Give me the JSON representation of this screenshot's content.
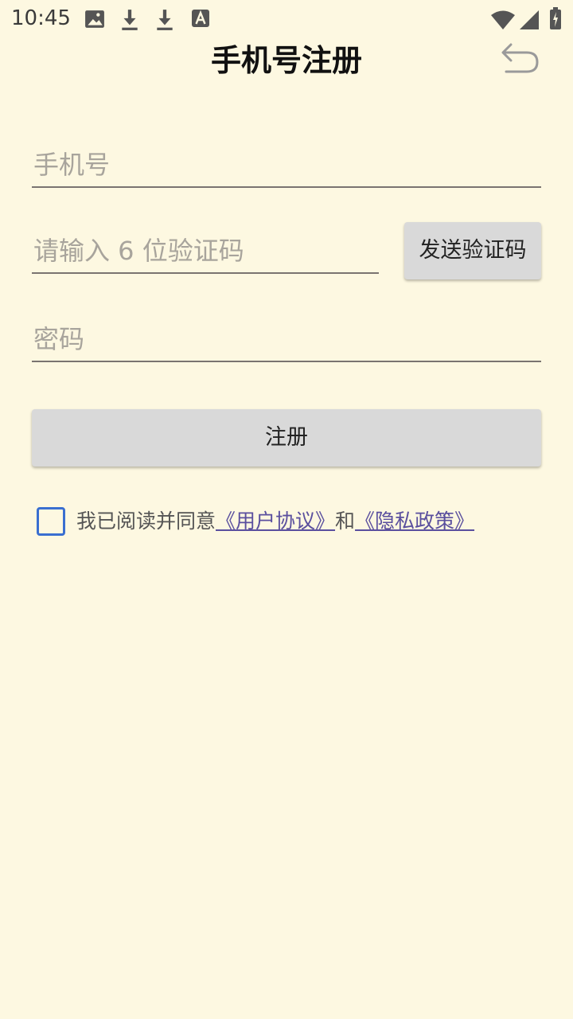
{
  "status_bar": {
    "time": "10:45",
    "left_icons": [
      "image-icon",
      "download-icon",
      "download-icon",
      "font-a-icon"
    ],
    "right_icons": [
      "wifi-icon",
      "signal-icon",
      "battery-icon"
    ]
  },
  "header": {
    "title": "手机号注册",
    "back_icon": "undo-arrow-icon"
  },
  "form": {
    "phone": {
      "placeholder": "手机号",
      "value": ""
    },
    "code": {
      "placeholder": "请输入 6 位验证码",
      "value": ""
    },
    "send_code_label": "发送验证码",
    "password": {
      "placeholder": "密码",
      "value": ""
    },
    "register_label": "注册"
  },
  "agreement": {
    "checked": false,
    "prefix": "我已阅读并同意",
    "user_agreement": "《用户协议》",
    "and": "和",
    "privacy_policy": "《隐私政策》"
  },
  "colors": {
    "background": "#fdf8e1",
    "button": "#d9d9d9",
    "checkbox": "#3a6fd0",
    "link": "#5a4f9e"
  }
}
